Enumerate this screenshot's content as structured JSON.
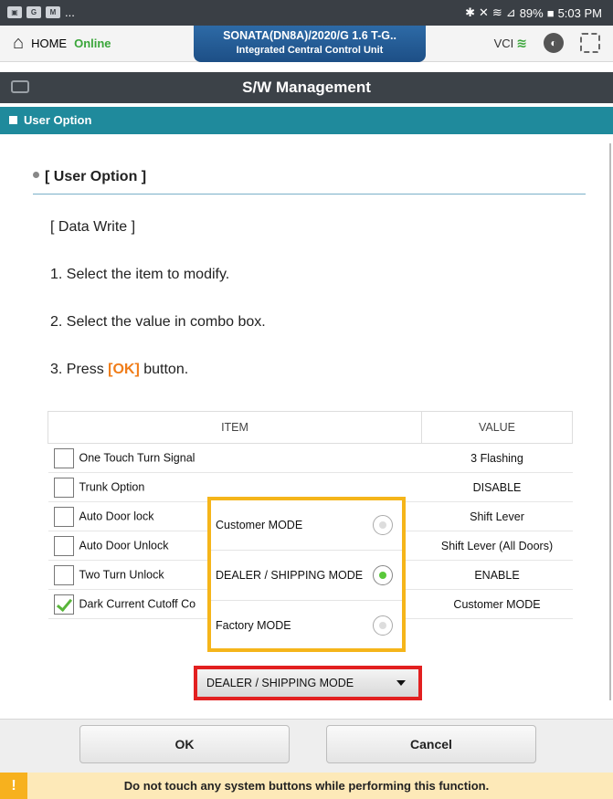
{
  "status_bar": {
    "notifications": "...",
    "battery": "89%",
    "time": "5:03 PM"
  },
  "header": {
    "home_label": "HOME",
    "connection_status": "Online",
    "vehicle_line1": "SONATA(DN8A)/2020/G 1.6 T-G..",
    "vehicle_line2": "Integrated Central Control Unit",
    "vci_label": "VCI"
  },
  "page": {
    "title": "S/W Management",
    "section_label": "User Option"
  },
  "content": {
    "heading": "[ User Option ]",
    "subheading": "[ Data Write ]",
    "step1": "1. Select the item to modify.",
    "step2": "2. Select the value in combo box.",
    "step3_prefix": "3. Press ",
    "step3_ok": "[OK]",
    "step3_suffix": " button."
  },
  "table": {
    "col_item": "ITEM",
    "col_value": "VALUE",
    "rows": [
      {
        "item": "One Touch Turn Signal",
        "value": "3 Flashing",
        "checked": false
      },
      {
        "item": "Trunk Option",
        "value": "DISABLE",
        "checked": false
      },
      {
        "item": "Auto Door lock",
        "value": "Shift Lever",
        "checked": false
      },
      {
        "item": "Auto Door Unlock",
        "value": "Shift Lever (All Doors)",
        "checked": false
      },
      {
        "item": "Two Turn Unlock",
        "value": "ENABLE",
        "checked": false
      },
      {
        "item": "Dark Current Cutoff Co",
        "value": "Customer MODE",
        "checked": true
      }
    ]
  },
  "dropdown_options": [
    {
      "label": "Customer MODE",
      "selected": false
    },
    {
      "label": "DEALER / SHIPPING MODE",
      "selected": true
    },
    {
      "label": "Factory MODE",
      "selected": false
    }
  ],
  "combo": {
    "selected": "DEALER / SHIPPING MODE"
  },
  "footer": {
    "ok_label": "OK",
    "cancel_label": "Cancel"
  },
  "warning": {
    "icon": "!",
    "text": "Do not touch any system buttons while performing this function."
  },
  "colors": {
    "section": "#1f8a9c",
    "ok_highlight": "#f07d1a",
    "popup_border": "#f5b51a",
    "combo_border": "#e22020",
    "online": "#3aa63a"
  }
}
